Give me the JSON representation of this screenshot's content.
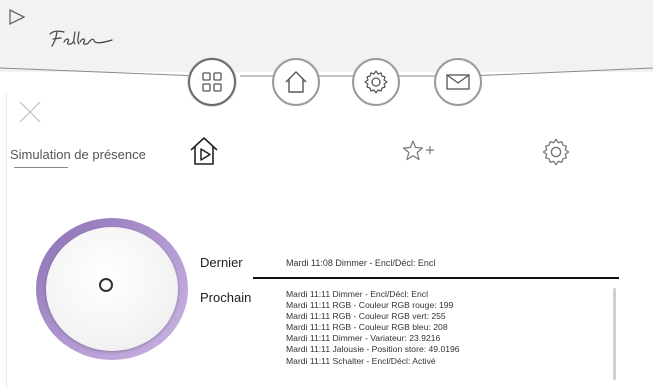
{
  "header": {
    "logo_text": "Feller",
    "nav": [
      {
        "name": "grid",
        "icon": "grid-icon",
        "active": true
      },
      {
        "name": "home",
        "icon": "home-icon",
        "active": false
      },
      {
        "name": "settings",
        "icon": "gear-icon",
        "active": false
      },
      {
        "name": "messages",
        "icon": "mail-icon",
        "active": false
      }
    ]
  },
  "page": {
    "title": "Simulation de présence",
    "close_icon": "close-icon",
    "tabs": [
      {
        "icon": "home-play-icon"
      },
      {
        "icon": "star-plus-icon"
      },
      {
        "icon": "gear-icon"
      }
    ]
  },
  "simulation": {
    "dial_icon": "power-circle",
    "last_label": "Dernier",
    "last_entry": "Mardi 11:08 Dimmer - Encl/Décl: Encl",
    "next_label": "Prochain",
    "next_entries": [
      "Mardi 11:11 Dimmer - Encl/Décl: Encl",
      "Mardi 11:11 RGB - Couleur RGB rouge: 199",
      "Mardi 11:11 RGB - Couleur RGB vert: 255",
      "Mardi 11:11 RGB - Couleur RGB bleu: 208",
      "Mardi 11:11 Dimmer - Variateur: 23.9216",
      "Mardi 11:11 Jalousie - Position store: 49.0196",
      "Mardi 11:11 Schalter - Encl/Décl: Activé"
    ]
  },
  "colors": {
    "dial_ring": "#9a7fc2",
    "header_bg": "#f2f2f2"
  }
}
